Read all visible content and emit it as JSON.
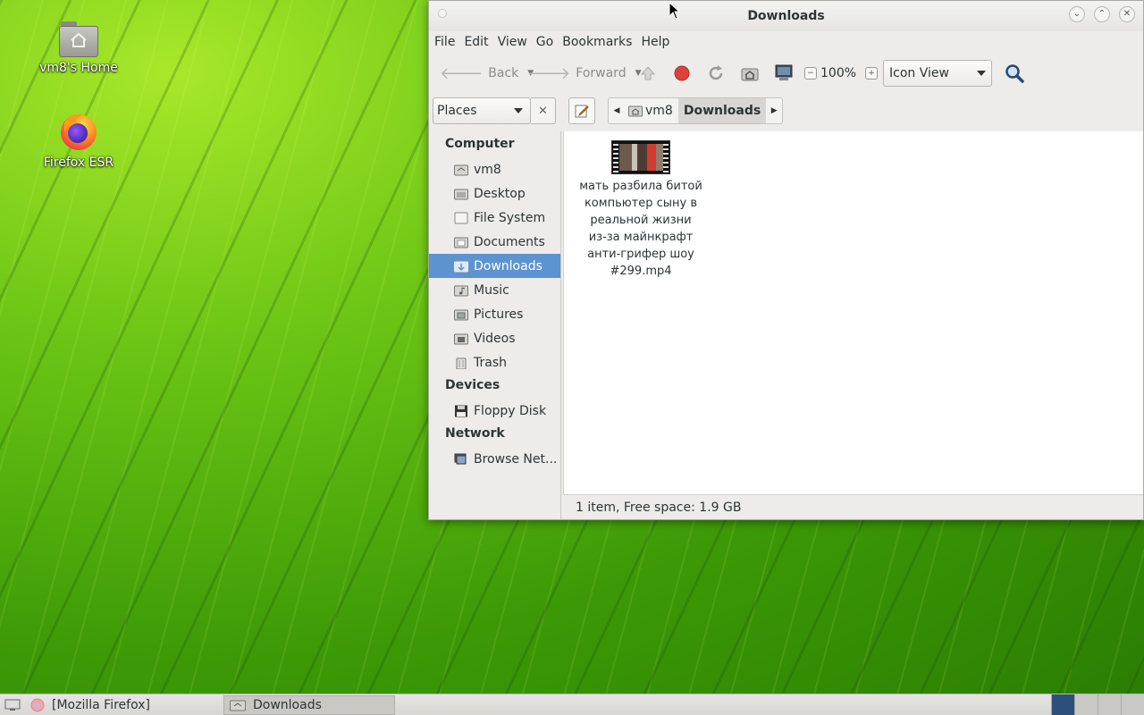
{
  "desktop": {
    "icons": [
      {
        "label": "vm8's Home",
        "icon": "home-folder-icon"
      },
      {
        "label": "Firefox ESR",
        "icon": "firefox-icon"
      }
    ]
  },
  "window": {
    "title": "Downloads",
    "menu": [
      "File",
      "Edit",
      "View",
      "Go",
      "Bookmarks",
      "Help"
    ],
    "toolbar": {
      "back_label": "Back",
      "forward_label": "Forward",
      "zoom": "100%",
      "view_mode": "Icon View"
    },
    "location": {
      "side_pane_selector": "Places",
      "breadcrumbs": [
        "vm8",
        "Downloads"
      ]
    },
    "sidebar": {
      "sections": [
        {
          "heading": "Computer",
          "items": [
            "vm8",
            "Desktop",
            "File System",
            "Documents",
            "Downloads",
            "Music",
            "Pictures",
            "Videos",
            "Trash"
          ]
        },
        {
          "heading": "Devices",
          "items": [
            "Floppy Disk"
          ]
        },
        {
          "heading": "Network",
          "items": [
            "Browse Net..."
          ]
        }
      ],
      "selected": "Downloads"
    },
    "files": [
      {
        "name_lines": [
          "мать разбила битой",
          "компьютер сыну в",
          "реальной жизни",
          "из-за майнкрафт",
          "анти-грифер шоу",
          "#299.mp4"
        ],
        "type": "video"
      }
    ],
    "status": "1 item, Free space: 1.9 GB"
  },
  "taskbar": {
    "tasks": [
      "[Mozilla Firefox]",
      "Downloads"
    ],
    "active_task": "Downloads"
  },
  "colors": {
    "selection": "#5d93d1",
    "desktop_green": "#4fa80c"
  }
}
